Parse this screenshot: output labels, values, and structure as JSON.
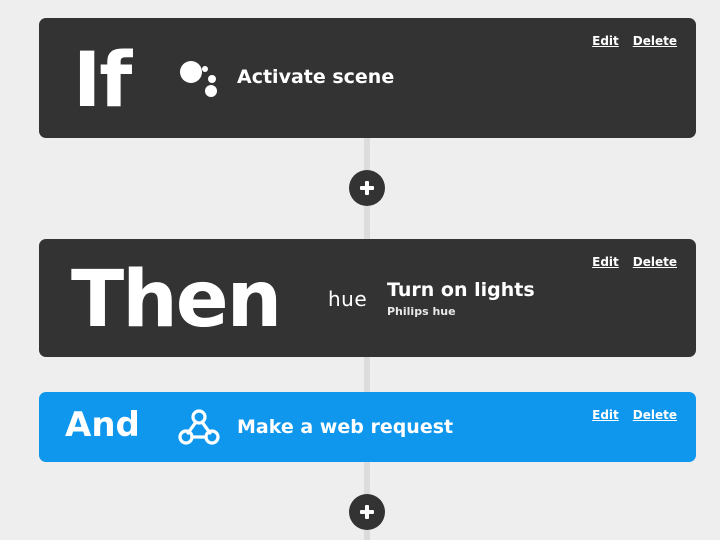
{
  "trigger": {
    "keyword": "If",
    "service_icon": "google-assistant-icon",
    "title": "Activate scene",
    "edit_label": "Edit",
    "delete_label": "Delete"
  },
  "add_buttons": [
    {
      "icon": "plus-icon"
    },
    {
      "icon": "plus-icon"
    }
  ],
  "action_1": {
    "keyword": "Then",
    "service_logo": "hue",
    "title": "Turn on lights",
    "subtitle": "Philips hue",
    "edit_label": "Edit",
    "delete_label": "Delete"
  },
  "action_2": {
    "keyword": "And",
    "service_icon": "webhooks-icon",
    "title": "Make a web request",
    "edit_label": "Edit",
    "delete_label": "Delete"
  },
  "colors": {
    "background": "#eeeeee",
    "card_dark": "#333333",
    "card_blue": "#0f97ee",
    "text": "#ffffff"
  }
}
